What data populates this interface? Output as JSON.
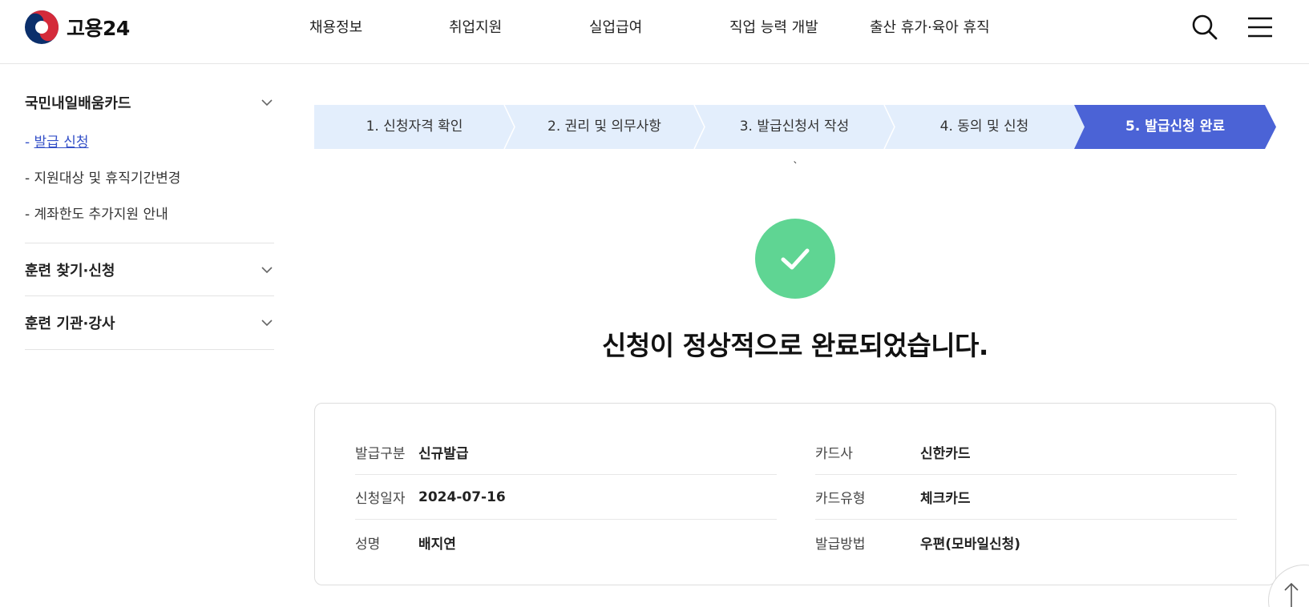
{
  "header": {
    "logo_text": "고용24",
    "nav": [
      "채용정보",
      "취업지원",
      "실업급여",
      "직업 능력 개발",
      "출산 휴가·육아 휴직"
    ],
    "icons": {
      "search": "search-icon",
      "menu": "hamburger-menu-icon"
    }
  },
  "sidebar": {
    "groups": [
      {
        "title": "국민내일배움카드",
        "items": [
          {
            "label": "발급 신청",
            "active": true
          },
          {
            "label": "지원대상 및 휴직기간변경",
            "active": false
          },
          {
            "label": "계좌한도 추가지원 안내",
            "active": false
          }
        ]
      },
      {
        "title": "훈련 찾기·신청",
        "items": []
      },
      {
        "title": "훈련 기관·강사",
        "items": []
      }
    ],
    "bullet": "- "
  },
  "stepper": {
    "steps": [
      "1. 신청자격 확인",
      "2. 권리 및 의무사항",
      "3. 발급신청서 작성",
      "4. 동의 및 신청",
      "5. 발급신청 완료"
    ],
    "current_index": 4,
    "colors": {
      "inactive": "#e3eefc",
      "active": "#4b63d6"
    }
  },
  "stray_mark": "`",
  "result": {
    "message": "신청이 정상적으로 완료되었습니다.",
    "check_color": "#5fd593"
  },
  "info": {
    "left": [
      {
        "label": "발급구분",
        "value": "신규발급"
      },
      {
        "label": "신청일자",
        "value": "2024-07-16"
      },
      {
        "label": "성명",
        "value": "배지연"
      }
    ],
    "right": [
      {
        "label": "카드사",
        "value": "신한카드"
      },
      {
        "label": "카드유형",
        "value": "체크카드"
      },
      {
        "label": "발급방법",
        "value": "우편(모바일신청)"
      }
    ]
  }
}
